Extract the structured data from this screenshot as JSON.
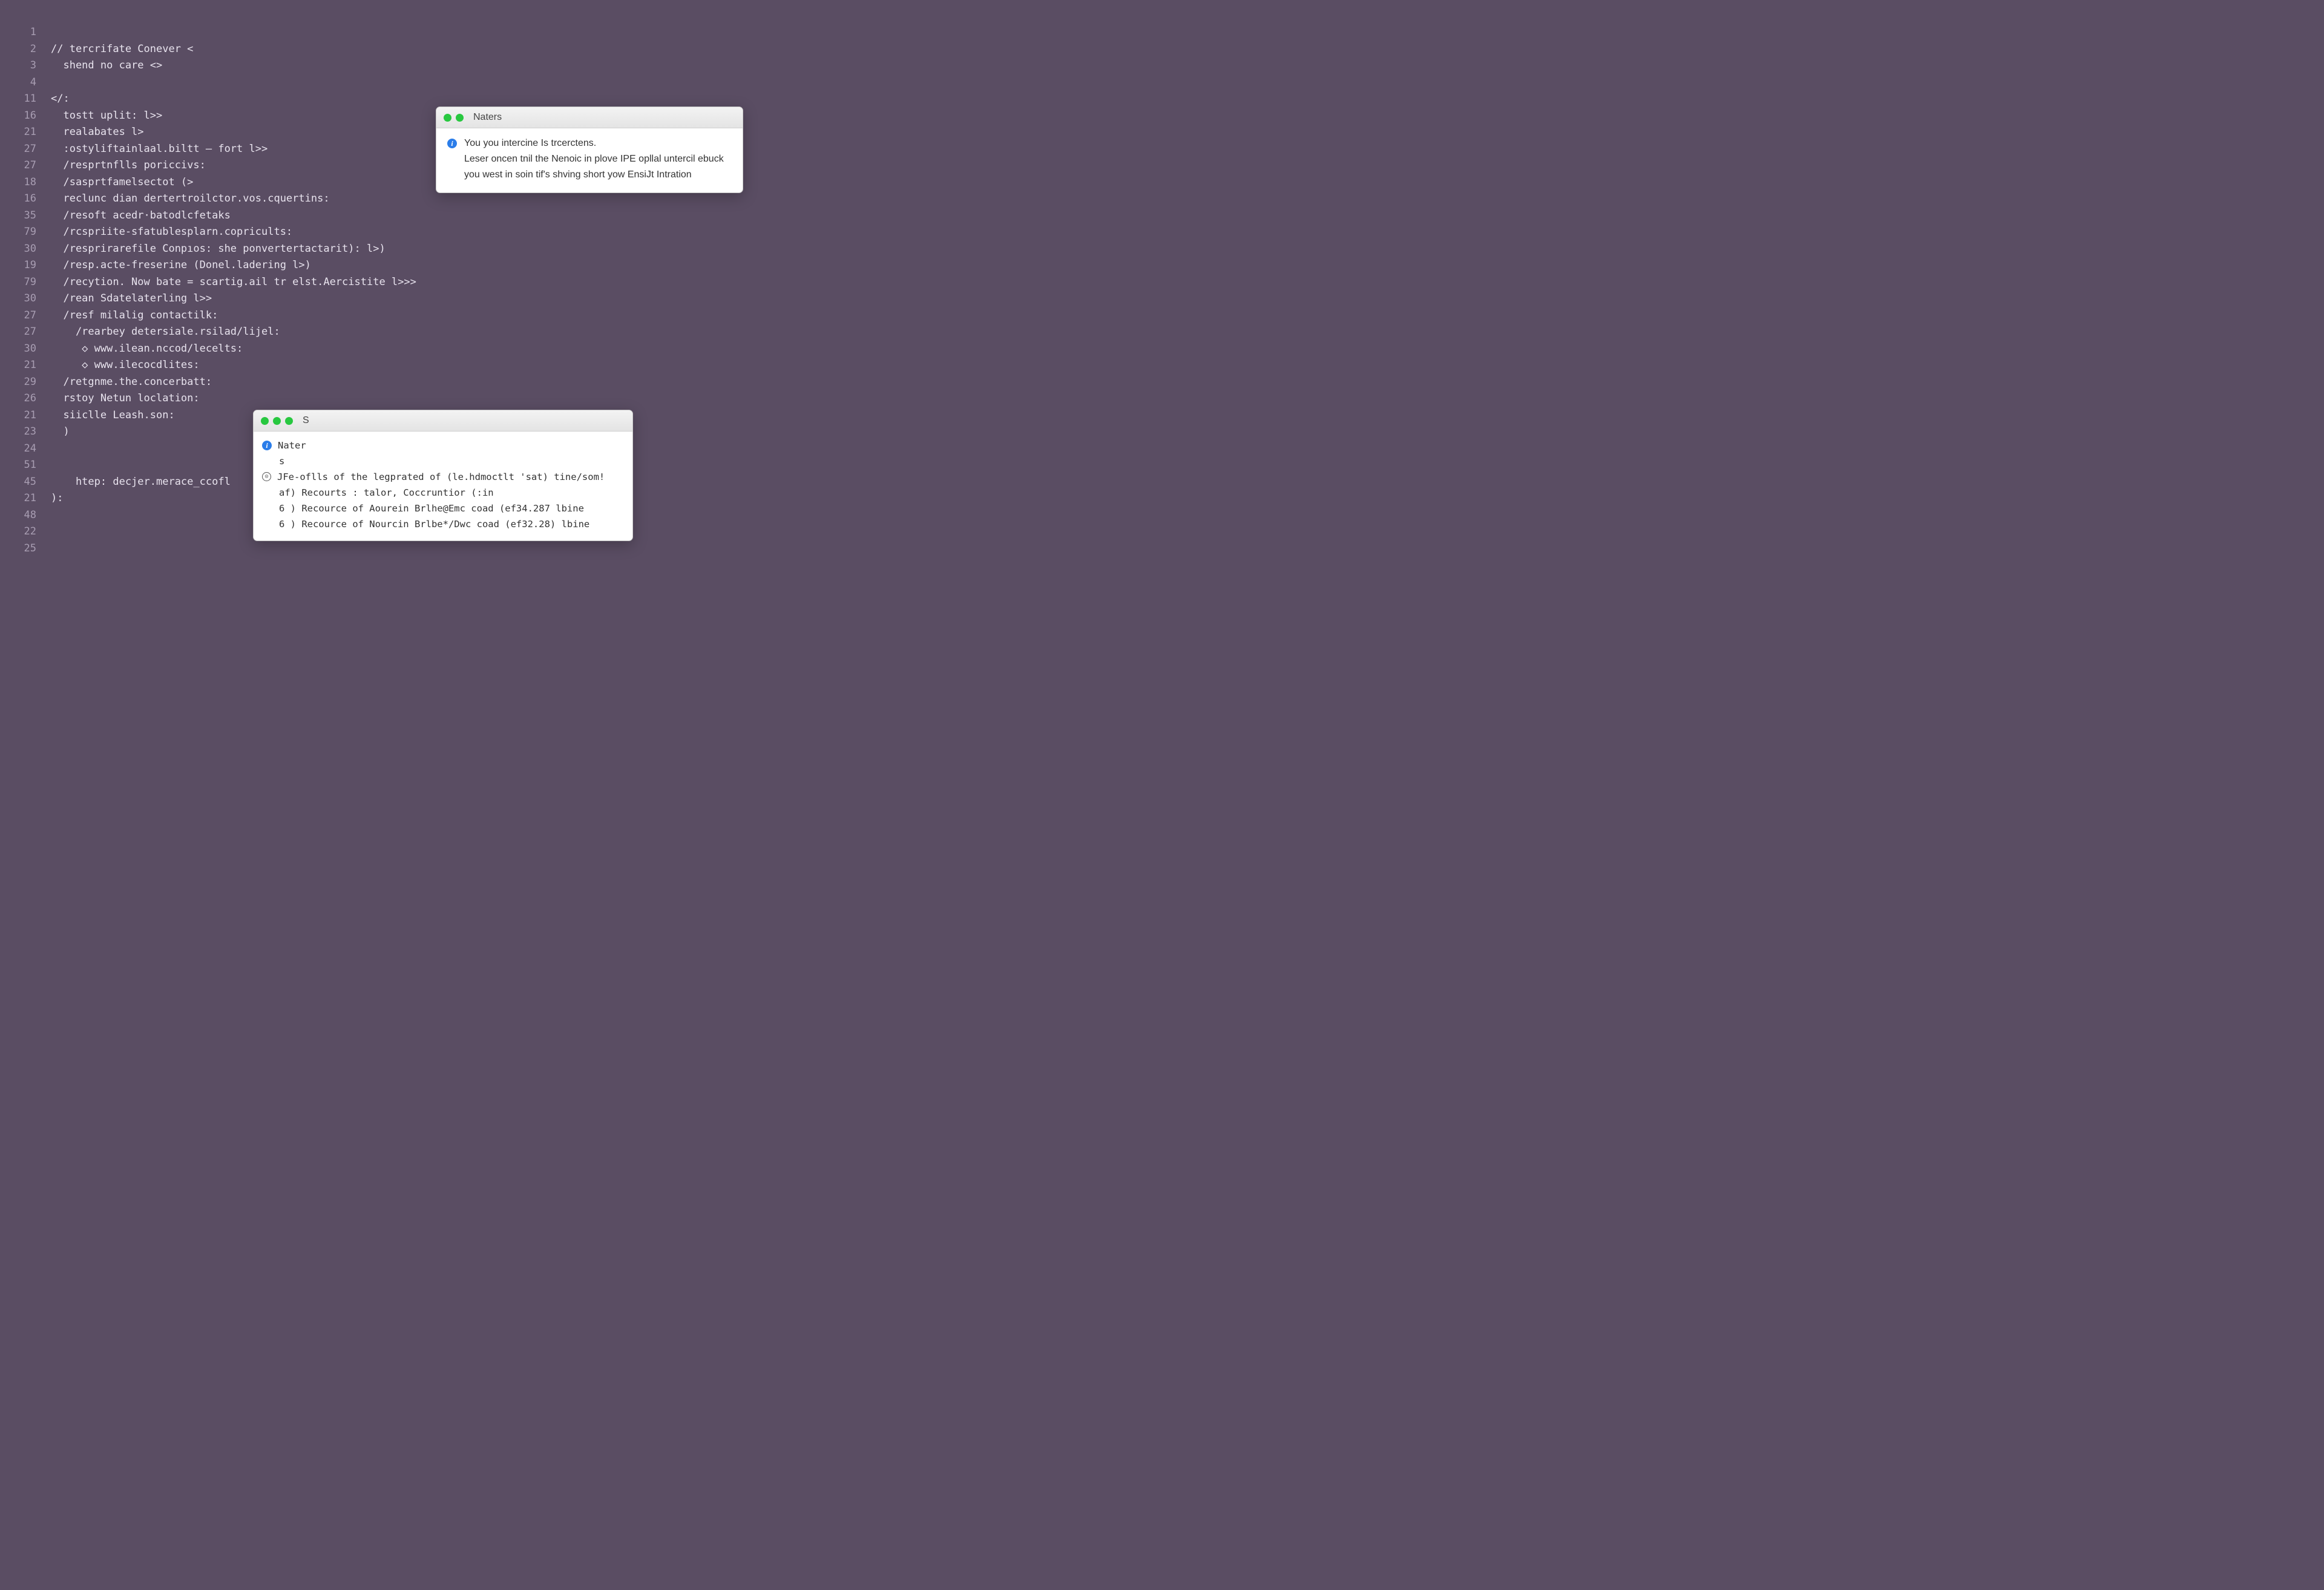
{
  "editor": {
    "lines": [
      {
        "num": "1",
        "text": ""
      },
      {
        "num": "2",
        "text": "// tercrifate Conever <"
      },
      {
        "num": "3",
        "text": "  shend no care <>"
      },
      {
        "num": "4",
        "text": ""
      },
      {
        "num": "11",
        "text": "</:"
      },
      {
        "num": "16",
        "text": "  tostt uplit: l>>"
      },
      {
        "num": "21",
        "text": "  realabates l>"
      },
      {
        "num": "27",
        "text": "  :ostyliftainlaal.biltt – fort l>>"
      },
      {
        "num": "27",
        "text": "  /resprtnflls poriccivs:"
      },
      {
        "num": "18",
        "text": "  /sasprtfamelsectot (>"
      },
      {
        "num": "16",
        "text": "  reclunc dian dertertroilctor.vos.cquertins:"
      },
      {
        "num": "35",
        "text": "  /resoft acedr·batodlcfetaks"
      },
      {
        "num": "79",
        "text": "  /rcspriite-sfatublesplarn.copricults:"
      },
      {
        "num": "30",
        "text": "  /resprirarefile Conpıos: she ponvertertactarit): l>)"
      },
      {
        "num": "19",
        "text": "  /resp.acte-freserine (Donel.ladering l>)"
      },
      {
        "num": "79",
        "text": "  /recytion. Now bate = scartig.ail tr elst.Aercistite l>>>"
      },
      {
        "num": "30",
        "text": "  /rean Sdatelaterling l>>"
      },
      {
        "num": "27",
        "text": "  /resf milalig contactilk:"
      },
      {
        "num": "27",
        "text": "    /rearbey detersiale.rsilad/lijel:"
      },
      {
        "num": "30",
        "text": "     ◇ www.ilean.nccod/lecelts:"
      },
      {
        "num": "21",
        "text": "     ◇ www.ilecocdlites:"
      },
      {
        "num": "29",
        "text": "  /retgnme.the.concerbatt:"
      },
      {
        "num": "26",
        "text": "  rstoy Netun loclation:"
      },
      {
        "num": "21",
        "text": "  siiclle Leash.son:"
      },
      {
        "num": "23",
        "text": "  )"
      },
      {
        "num": "24",
        "text": ""
      },
      {
        "num": "51",
        "text": ""
      },
      {
        "num": "45",
        "text": "    htep: decjer.merace_ccofl"
      },
      {
        "num": "21",
        "text": "):"
      },
      {
        "num": "48",
        "text": ""
      },
      {
        "num": "22",
        "text": ""
      },
      {
        "num": "25",
        "text": ""
      }
    ]
  },
  "panel1": {
    "title": "Naters",
    "line1": "You you intercine Is trcerctens.",
    "body": "Leser oncen tnil the Nenoic in plove IPE opllal untercil ebuck you west in soin tif's shving short yow EnsiJt Intration"
  },
  "panel2": {
    "title": "S",
    "heading": "Nater",
    "sub": "s",
    "rows": [
      "JFe-oflls of the legprated of (le.hdmoctlt 'sat) tine/som!",
      "af) Recourts : talor, Coccruntior (:in",
      "6 ) Recource of Aourein Brlhe@Emc coad (ef34.287 lbine",
      "6 ) Recource of Nourcin Brlbe*/Dwc coad (ef32.28) lbine"
    ]
  }
}
